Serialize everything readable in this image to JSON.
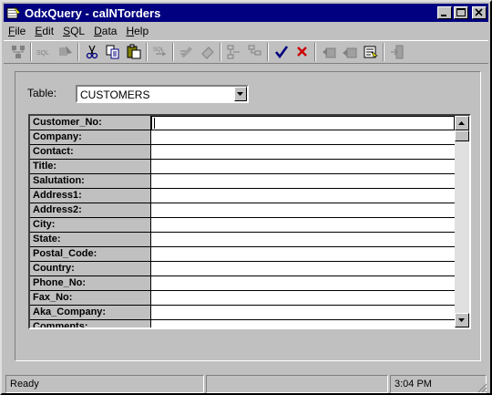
{
  "window": {
    "title": "OdxQuery - calNTorders"
  },
  "menu": [
    {
      "key": "F",
      "rest": "ile"
    },
    {
      "key": "E",
      "rest": "dit"
    },
    {
      "key": "S",
      "rest": "QL"
    },
    {
      "key": "D",
      "rest": "ata"
    },
    {
      "key": "H",
      "rest": "elp"
    }
  ],
  "toolbar": {
    "icons": [
      "connect-icon",
      "sql-icon",
      "sql-run-icon",
      "cut-icon",
      "copy-icon",
      "paste-icon",
      "sql-query-icon",
      "edit-icon",
      "eraser-icon",
      "insert-row-icon",
      "delete-row-icon",
      "checkmark-icon",
      "cancel-x-icon",
      "record-first-icon",
      "record-prev-icon",
      "record-open-icon",
      "exit-icon"
    ],
    "sql_label": "SQL",
    "accent_check": "#000080",
    "accent_x": "#cc0000"
  },
  "form": {
    "table_label": "Table:",
    "table_value": "CUSTOMERS",
    "fields": [
      {
        "label": "Customer_No:",
        "value": ""
      },
      {
        "label": "Company:",
        "value": ""
      },
      {
        "label": "Contact:",
        "value": ""
      },
      {
        "label": "Title:",
        "value": ""
      },
      {
        "label": "Salutation:",
        "value": ""
      },
      {
        "label": "Address1:",
        "value": ""
      },
      {
        "label": "Address2:",
        "value": ""
      },
      {
        "label": "City:",
        "value": ""
      },
      {
        "label": "State:",
        "value": ""
      },
      {
        "label": "Postal_Code:",
        "value": ""
      },
      {
        "label": "Country:",
        "value": ""
      },
      {
        "label": "Phone_No:",
        "value": ""
      },
      {
        "label": "Fax_No:",
        "value": ""
      },
      {
        "label": "Aka_Company:",
        "value": ""
      },
      {
        "label": "Comments:",
        "value": ""
      }
    ]
  },
  "status": {
    "message": "Ready",
    "middle": "",
    "time": "3:04 PM"
  }
}
